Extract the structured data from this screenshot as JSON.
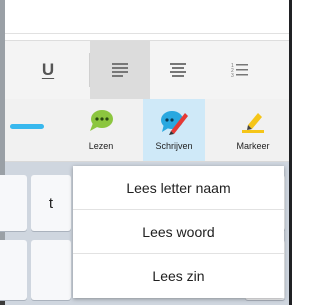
{
  "format_toolbar": {
    "underline_label": "U",
    "buttons": [
      "underline-button",
      "align-left-button",
      "align-center-button",
      "numbered-list-button"
    ]
  },
  "reading_toolbar": {
    "tools": [
      {
        "label": "Lezen",
        "icon": "speech-bubble-icon",
        "color": "#8cc63f"
      },
      {
        "label": "Schrijven",
        "icon": "speech-bubble-pen-icon",
        "color": "#29a8e0"
      },
      {
        "label": "Markeer",
        "icon": "marker-icon",
        "color": "#f5c518"
      }
    ],
    "active": "Schrijven"
  },
  "keyboard": {
    "visible_key": "t"
  },
  "popup_menu": {
    "items": [
      "Lees letter naam",
      "Lees woord",
      "Lees zin"
    ]
  },
  "colors": {
    "accent": "#38b8ee",
    "active_tool_bg": "#cfe9f8"
  }
}
